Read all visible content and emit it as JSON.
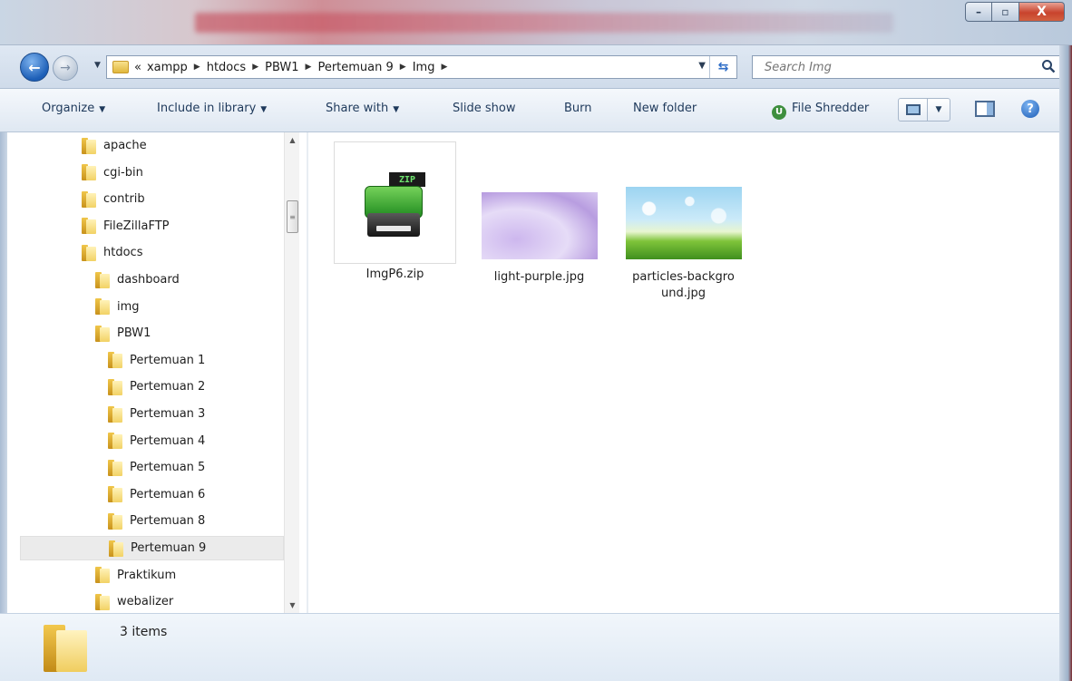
{
  "window": {
    "minimize_label": "–",
    "maximize_label": "▫",
    "close_label": "X"
  },
  "nav": {
    "back_glyph": "←",
    "forward_glyph": "→",
    "overflow": "«",
    "breadcrumbs": [
      "xampp",
      "htdocs",
      "PBW1",
      "Pertemuan 9",
      "Img"
    ],
    "search_placeholder": "Search Img"
  },
  "toolbar": {
    "organize": "Organize",
    "include_in_library": "Include in library",
    "share_with": "Share with",
    "slide_show": "Slide show",
    "burn": "Burn",
    "new_folder": "New folder",
    "file_shredder": "File Shredder"
  },
  "tree": [
    {
      "label": "apache",
      "level": 0
    },
    {
      "label": "cgi-bin",
      "level": 0
    },
    {
      "label": "contrib",
      "level": 0
    },
    {
      "label": "FileZillaFTP",
      "level": 0
    },
    {
      "label": "htdocs",
      "level": 0
    },
    {
      "label": "dashboard",
      "level": 1
    },
    {
      "label": "img",
      "level": 1
    },
    {
      "label": "PBW1",
      "level": 1
    },
    {
      "label": "Pertemuan 1",
      "level": 2
    },
    {
      "label": "Pertemuan 2",
      "level": 2
    },
    {
      "label": "Pertemuan 3",
      "level": 2
    },
    {
      "label": "Pertemuan 4",
      "level": 2
    },
    {
      "label": "Pertemuan 5",
      "level": 2
    },
    {
      "label": "Pertemuan 6",
      "level": 2
    },
    {
      "label": "Pertemuan 8",
      "level": 2
    },
    {
      "label": "Pertemuan 9",
      "level": 2,
      "selected": true
    },
    {
      "label": "Praktikum",
      "level": 1
    },
    {
      "label": "webalizer",
      "level": 1
    }
  ],
  "files": [
    {
      "name": "ImgP6.zip",
      "icon": "zip-archive-icon",
      "badge": "ZIP"
    },
    {
      "name": "light-purple.jpg",
      "icon": "image-thumbnail"
    },
    {
      "name_line1": "particles-backgro",
      "name_line2": "und.jpg",
      "icon": "image-thumbnail"
    }
  ],
  "status": {
    "item_count": "3 items"
  },
  "colors": {
    "accent": "#1e395b",
    "selection": "#ebebeb",
    "close_button": "#c8432d"
  }
}
